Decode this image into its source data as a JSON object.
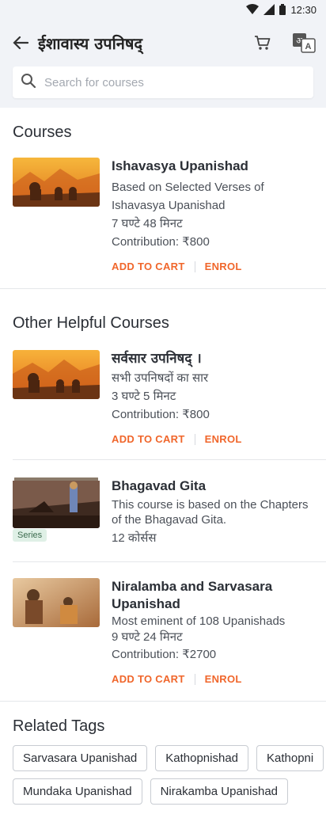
{
  "status": {
    "time": "12:30"
  },
  "appbar": {
    "title": "ईशावास्य उपनिषद्"
  },
  "search": {
    "placeholder": "Search for courses"
  },
  "courses": {
    "heading": "Courses",
    "items": [
      {
        "title": "Ishavasya Upanishad",
        "subtitle": "Based on Selected Verses of Ishavasya Upanishad",
        "duration": "7 घण्टे 48 मिनट",
        "contribution": "Contribution: ₹800",
        "add_to_cart": "ADD TO CART",
        "enrol": "ENROL"
      }
    ]
  },
  "other": {
    "heading": "Other Helpful Courses",
    "items": [
      {
        "title": "सर्वसार उपनिषद् ।",
        "subtitle": "सभी उपनिषदों का सार",
        "duration": "3 घण्टे 5 मिनट",
        "contribution": "Contribution: ₹800",
        "add_to_cart": "ADD TO CART",
        "enrol": "ENROL"
      },
      {
        "title": "Bhagavad Gita",
        "subtitle": "This course is based on the Chapters of the Bhagavad Gita.",
        "count": "12 कोर्सस",
        "badge": "Series"
      },
      {
        "title": "Niralamba and Sarvasara Upanishad",
        "subtitle": "Most eminent of 108 Upanishads",
        "duration": "9 घण्टे 24 मिनट",
        "contribution": "Contribution: ₹2700",
        "add_to_cart": "ADD TO CART",
        "enrol": "ENROL"
      }
    ]
  },
  "tags": {
    "heading": "Related Tags",
    "row1": [
      "Sarvasara Upanishad",
      "Kathopnishad",
      "Kathopni"
    ],
    "row2": [
      "Mundaka Upanishad",
      "Nirakamba Upanishad"
    ]
  },
  "colors": {
    "accent": "#f0662b",
    "appbar_bg": "#f1f3f7",
    "badge_bg": "#dff0e6"
  },
  "icons": [
    "wifi-icon",
    "signal-icon",
    "battery-icon",
    "back-arrow-icon",
    "cart-icon",
    "translate-icon",
    "search-icon"
  ]
}
